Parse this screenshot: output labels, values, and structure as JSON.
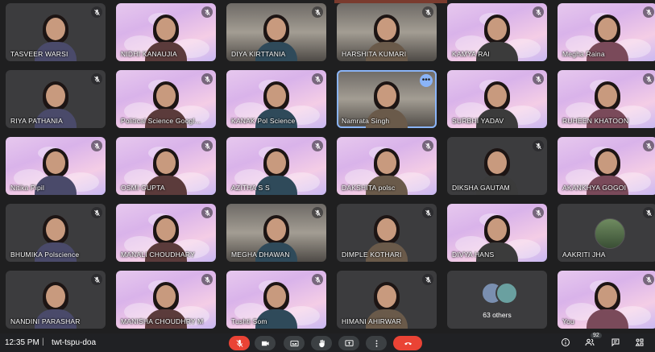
{
  "participants": [
    {
      "name": "TASVEER WARSI",
      "bg": "dark"
    },
    {
      "name": "NIDHI KANAUJIA",
      "bg": "pink"
    },
    {
      "name": "DIYA KIRTTANIA",
      "bg": "room"
    },
    {
      "name": "HARSHITA KUMARI",
      "bg": "room"
    },
    {
      "name": "KAMYA RAI",
      "bg": "pink"
    },
    {
      "name": "Megha Raina",
      "bg": "pink"
    },
    {
      "name": "RIYA PATHANIA",
      "bg": "dark"
    },
    {
      "name": "Political Science Googl...",
      "bg": "pink"
    },
    {
      "name": "KANAK Pol Science",
      "bg": "pink"
    },
    {
      "name": "Namrata Singh",
      "bg": "room",
      "active": true
    },
    {
      "name": "SURBHI YADAV",
      "bg": "pink"
    },
    {
      "name": "RUHEEN KHATOON",
      "bg": "pink"
    },
    {
      "name": "Nitika Pipil",
      "bg": "pink"
    },
    {
      "name": "OSMI GUPTA",
      "bg": "pink"
    },
    {
      "name": "AZITHA S S",
      "bg": "pink"
    },
    {
      "name": "DAKSHITA polsc",
      "bg": "pink"
    },
    {
      "name": "DIKSHA GAUTAM",
      "bg": "dark"
    },
    {
      "name": "AKANKHYA GOGOI",
      "bg": "pink"
    },
    {
      "name": "BHUMIKA Polscience",
      "bg": "dark"
    },
    {
      "name": "MANALI CHOUDHARY",
      "bg": "pink"
    },
    {
      "name": "MEGHA DHAWAN",
      "bg": "room"
    },
    {
      "name": "DIMPLE KOTHARI",
      "bg": "dark"
    },
    {
      "name": "DIVYA HANS",
      "bg": "pink"
    },
    {
      "name": "AAKRITI JHA",
      "bg": "dark",
      "avatar": true
    },
    {
      "name": "NANDINI PARASHAR",
      "bg": "dark"
    },
    {
      "name": "MANISHA CHOUDHRY M",
      "bg": "pink"
    },
    {
      "name": "Tushti Som",
      "bg": "pink"
    },
    {
      "name": "HIMANI AHIRWAR",
      "bg": "dark"
    },
    {
      "name": "",
      "bg": "dark",
      "others": "63 others"
    },
    {
      "name": "You",
      "bg": "pink"
    }
  ],
  "more_options_glyph": "•••",
  "toolbar": {
    "time": "12:35 PM",
    "separator": "|",
    "meeting_code": "twt-tspu-doa",
    "participants_count": "92"
  },
  "colors": {
    "accent": "#8ab4f8",
    "danger": "#ea4335",
    "background": "#1f1f20",
    "tile_dark": "#3c3c3e"
  }
}
